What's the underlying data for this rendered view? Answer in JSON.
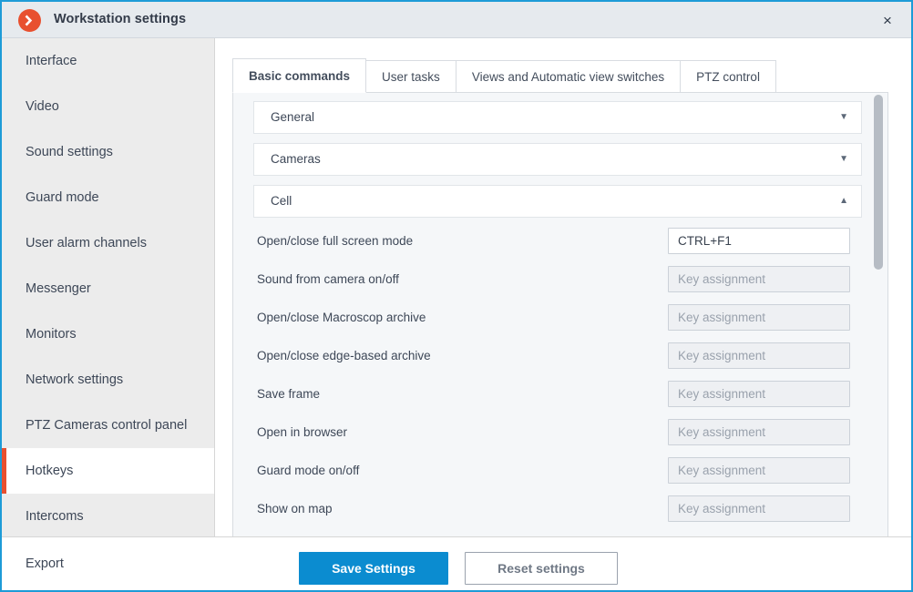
{
  "window": {
    "title": "Workstation settings",
    "close_label": "×",
    "logo_icon": "chevron-right-circle-icon",
    "accent_color": "#e8502f",
    "border_color": "#1e9bd7"
  },
  "sidebar": {
    "items": [
      {
        "label": "Interface",
        "selected": false
      },
      {
        "label": "Video",
        "selected": false
      },
      {
        "label": "Sound settings",
        "selected": false
      },
      {
        "label": "Guard mode",
        "selected": false
      },
      {
        "label": "User alarm channels",
        "selected": false
      },
      {
        "label": "Messenger",
        "selected": false
      },
      {
        "label": "Monitors",
        "selected": false
      },
      {
        "label": "Network settings",
        "selected": false
      },
      {
        "label": "PTZ Cameras control panel",
        "selected": false
      },
      {
        "label": "Hotkeys",
        "selected": true
      },
      {
        "label": "Intercoms",
        "selected": false
      }
    ]
  },
  "tabs": [
    {
      "label": "Basic commands",
      "active": true
    },
    {
      "label": "User tasks",
      "active": false
    },
    {
      "label": "Views and Automatic view switches",
      "active": false
    },
    {
      "label": "PTZ control",
      "active": false
    }
  ],
  "groups": [
    {
      "label": "General",
      "expanded": false,
      "arrow_icon": "chevron-down-icon",
      "arrow_glyph": "▼"
    },
    {
      "label": "Cameras",
      "expanded": false,
      "arrow_icon": "chevron-down-icon",
      "arrow_glyph": "▼"
    },
    {
      "label": "Cell",
      "expanded": true,
      "arrow_icon": "chevron-up-icon",
      "arrow_glyph": "▲"
    }
  ],
  "hotkeys": {
    "placeholder": "Key assignment",
    "rows": [
      {
        "label": "Open/close full screen mode",
        "value": "CTRL+F1"
      },
      {
        "label": "Sound from camera on/off",
        "value": ""
      },
      {
        "label": "Open/close Macroscop archive",
        "value": ""
      },
      {
        "label": "Open/close edge-based archive",
        "value": ""
      },
      {
        "label": "Save frame",
        "value": ""
      },
      {
        "label": "Open in browser",
        "value": ""
      },
      {
        "label": "Guard mode on/off",
        "value": ""
      },
      {
        "label": "Show on map",
        "value": ""
      }
    ]
  },
  "footer": {
    "export_label": "Export",
    "save_label": "Save Settings",
    "reset_label": "Reset settings",
    "save_color": "#0b8cd0"
  }
}
